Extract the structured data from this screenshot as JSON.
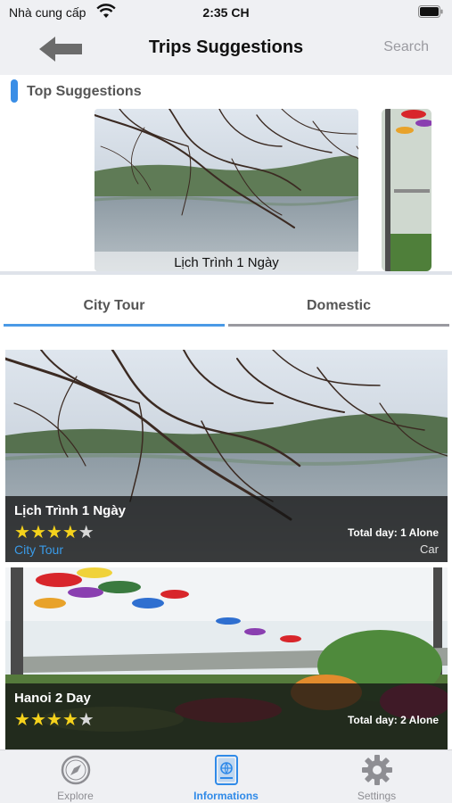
{
  "status_bar": {
    "carrier": "Nhà cung cấp",
    "time": "2:35 CH"
  },
  "nav": {
    "title": "Trips Suggestions",
    "search_label": "Search"
  },
  "top_suggestions": {
    "heading": "Top Suggestions",
    "items": [
      {
        "caption": "Lịch Trình 1 Ngày"
      }
    ]
  },
  "tabs": [
    {
      "label": "City Tour"
    },
    {
      "label": "Domestic"
    }
  ],
  "trips": [
    {
      "name": "Lịch Trình 1 Ngày",
      "rating": 4,
      "total": "Total day: 1 Alone",
      "category": "City Tour",
      "transport": "Car"
    },
    {
      "name": "Hanoi 2 Day",
      "rating": 4,
      "total": "Total day: 2 Alone"
    }
  ],
  "tab_bar": [
    {
      "label": "Explore",
      "icon": "compass-icon"
    },
    {
      "label": "Informations",
      "icon": "passport-icon",
      "active": true
    },
    {
      "label": "Settings",
      "icon": "gear-icon"
    }
  ],
  "colors": {
    "accent": "#2f8ae8",
    "star": "#f5d21c",
    "nav_bg": "#eff0f3"
  }
}
